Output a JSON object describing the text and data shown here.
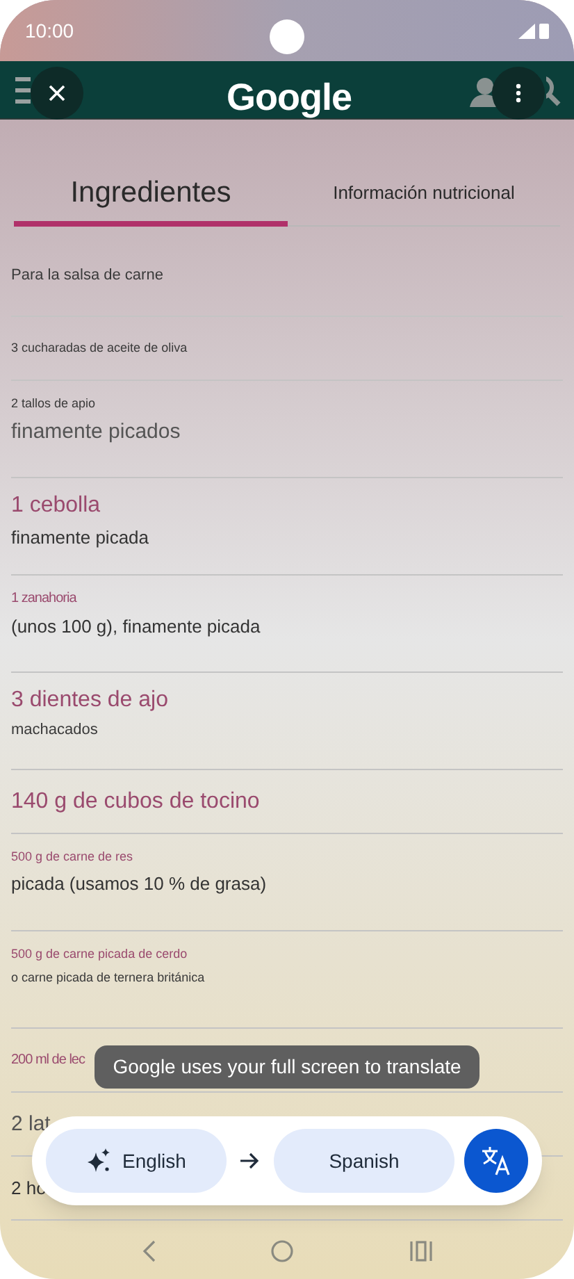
{
  "status_bar": {
    "time": "10:00"
  },
  "header": {
    "logo": "Google"
  },
  "tabs": [
    {
      "label": "Ingredientes",
      "selected": true
    },
    {
      "label": "Información nutricional",
      "selected": false
    }
  ],
  "ingredients": [
    {
      "lines": [
        {
          "text": "Para la salsa de carne",
          "kind": "plain_small"
        }
      ]
    },
    {
      "lines": [
        {
          "text": "3 cucharadas de aceite de oliva",
          "kind": "plain_tiny"
        }
      ]
    },
    {
      "lines": [
        {
          "text": "2 tallos de apio",
          "kind": "plain_tiny"
        },
        {
          "text": "finamente picados",
          "kind": "plain_large"
        }
      ]
    },
    {
      "lines": [
        {
          "text": "1 cebolla",
          "kind": "accent_large"
        },
        {
          "text": "finamente picada",
          "kind": "plain_medium"
        }
      ]
    },
    {
      "lines": [
        {
          "text": "1 zanahoria",
          "kind": "accent_small"
        },
        {
          "text": "(unos 100 g), finamente picada",
          "kind": "plain_medium"
        }
      ]
    },
    {
      "lines": [
        {
          "text": "3 dientes de ajo",
          "kind": "accent_large"
        },
        {
          "text": "machacados",
          "kind": "plain_small"
        }
      ]
    },
    {
      "lines": [
        {
          "text": "140 g de cubos de tocino",
          "kind": "accent_large"
        }
      ]
    },
    {
      "lines": [
        {
          "text": "500 g de carne de res",
          "kind": "accent_tiny"
        },
        {
          "text": "picada (usamos 10 % de grasa)",
          "kind": "plain_medium"
        }
      ]
    },
    {
      "lines": [
        {
          "text": "500 g de carne picada de cerdo",
          "kind": "accent_tiny"
        },
        {
          "text": "o carne picada de ternera británica",
          "kind": "plain_tiny"
        }
      ]
    },
    {
      "lines": [
        {
          "text": "200 ml de lec",
          "kind": "accent_small"
        }
      ]
    },
    {
      "lines": [
        {
          "text": "2 lat",
          "kind": "plain_large"
        }
      ]
    },
    {
      "lines": [
        {
          "text": "2 ho",
          "kind": "plain_medium"
        }
      ]
    }
  ],
  "toast": "Google uses your full screen to translate",
  "translate_bar": {
    "source_language": "English",
    "target_language": "Spanish"
  }
}
